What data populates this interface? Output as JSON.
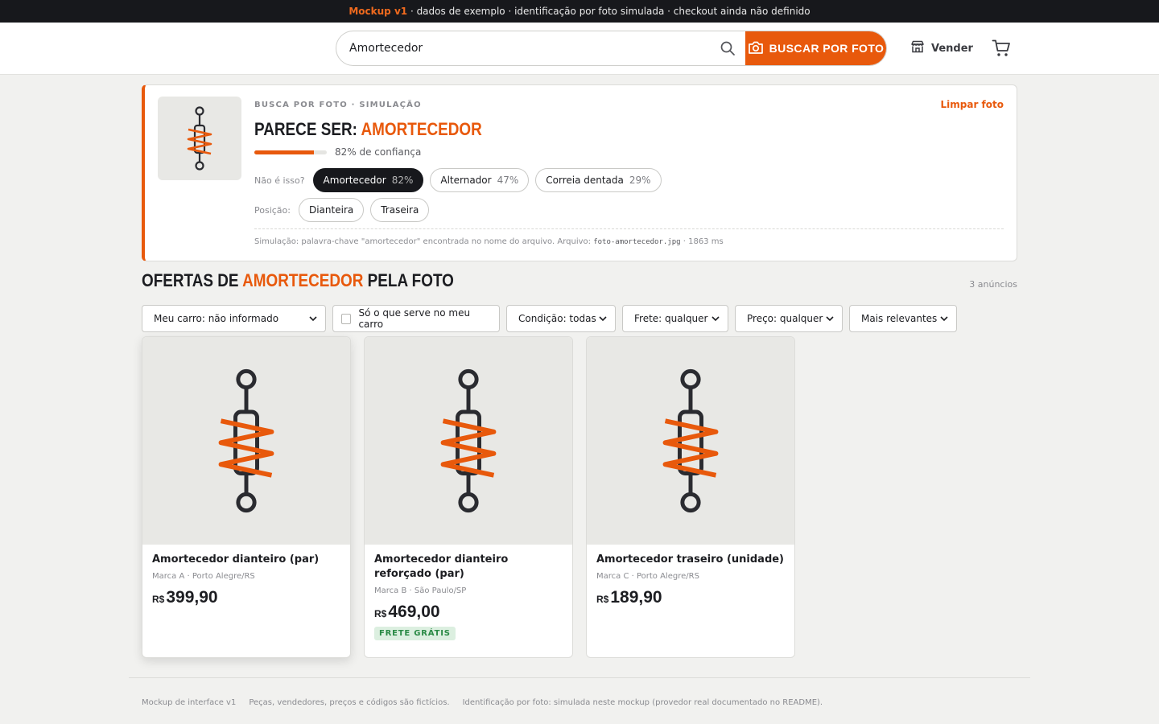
{
  "banner": {
    "accent": "Mockup v1",
    "text": " · dados de exemplo · identificação por foto simulada · checkout ainda não definido"
  },
  "header": {
    "search_value": "Amortecedor",
    "photo_button": "BUSCAR POR FOTO",
    "sell_label": "Vender"
  },
  "identification": {
    "kicker": "BUSCA POR FOTO · SIMULAÇÃO",
    "clear_label": "Limpar foto",
    "headline_prefix": "PARECE SER: ",
    "headline_item": "AMORTECEDOR",
    "confidence": 0.82,
    "confidence_text": "82% de confiança",
    "alternatives_label": "Não é isso?",
    "alternatives": [
      {
        "name": "Amortecedor",
        "pct": "82%",
        "selected": true
      },
      {
        "name": "Alternador",
        "pct": "47%",
        "selected": false
      },
      {
        "name": "Correia dentada",
        "pct": "29%",
        "selected": false
      }
    ],
    "position_label": "Posição:",
    "positions": [
      "Dianteira",
      "Traseira"
    ],
    "note_prefix": "Simulação: palavra-chave \"amortecedor\" encontrada no nome do arquivo. Arquivo: ",
    "note_file": "foto-amortecedor.jpg",
    "note_suffix": " · 1863 ms"
  },
  "results": {
    "title_prefix": "OFERTAS DE ",
    "title_item": "AMORTECEDOR",
    "title_suffix": " PELA FOTO",
    "count": "3 anúncios"
  },
  "filters": {
    "car": "Meu carro: não informado",
    "fit_only": "Só o que serve no meu carro",
    "condition": "Condição: todas",
    "shipping": "Frete: qualquer",
    "price": "Preço: qualquer",
    "sort": "Mais relevantes"
  },
  "products": [
    {
      "title": "Amortecedor dianteiro (par)",
      "meta": "Marca A · Porto Alegre/RS",
      "currency": "R$",
      "price": "399,90",
      "badge": ""
    },
    {
      "title": "Amortecedor dianteiro reforçado (par)",
      "meta": "Marca B · São Paulo/SP",
      "currency": "R$",
      "price": "469,00",
      "badge": "FRETE GRÁTIS"
    },
    {
      "title": "Amortecedor traseiro (unidade)",
      "meta": "Marca C · Porto Alegre/RS",
      "currency": "R$",
      "price": "189,90",
      "badge": ""
    }
  ],
  "footer": {
    "item1": "Mockup de interface v1",
    "item2": "Peças, vendedores, preços e códigos são fictícios.",
    "item3": "Identificação por foto: simulada neste mockup (provedor real documentado no README)."
  },
  "colors": {
    "accent": "#e8590c",
    "dark": "#17181c",
    "success": "#2a8a45"
  },
  "icons": [
    "search-icon",
    "camera-icon",
    "store-icon",
    "cart-icon",
    "shock-absorber-icon",
    "chevron-down-icon"
  ]
}
